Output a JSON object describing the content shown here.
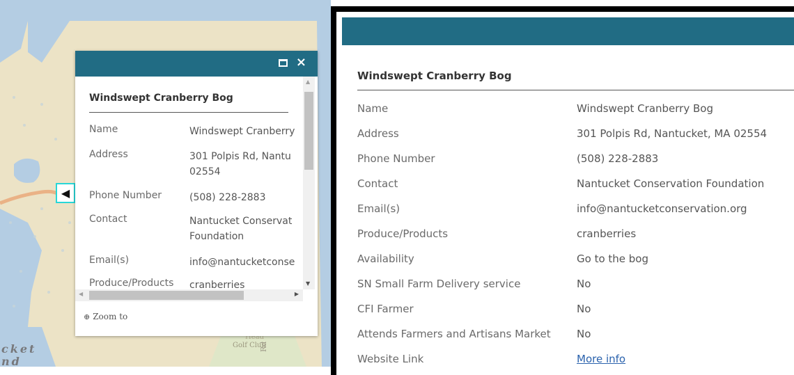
{
  "map": {
    "labels": {
      "ocean_line1": "cket",
      "ocean_line2": "nd",
      "golf_head": "Head",
      "golf_club": "Golf Club",
      "road": "Rd"
    }
  },
  "small_popup": {
    "pointer_icon": "chevron-left-icon",
    "maximize_icon": "maximize-icon",
    "close_icon": "close-icon",
    "close_glyph": "×",
    "title": "Windswept Cranberry Bog",
    "rows": [
      {
        "key": "Name",
        "value": "Windswept Cranberry"
      },
      {
        "key": "Address",
        "value": "301 Polpis Rd, Nantu 02554"
      },
      {
        "key": "Phone Number",
        "value": "(508) 228-2883"
      },
      {
        "key": "Contact",
        "value": "Nantucket Conservat Foundation"
      },
      {
        "key": "Email(s)",
        "value": "info@nantucketconse"
      },
      {
        "key": "Produce/Products",
        "value": "cranberries"
      }
    ],
    "zoom_label": "Zoom to"
  },
  "large_popup": {
    "title": "Windswept Cranberry Bog",
    "rows": [
      {
        "key": "Name",
        "value": "Windswept Cranberry Bog"
      },
      {
        "key": "Address",
        "value": "301 Polpis Rd, Nantucket, MA 02554"
      },
      {
        "key": "Phone Number",
        "value": "(508) 228-2883"
      },
      {
        "key": "Contact",
        "value": "Nantucket Conservation Foundation"
      },
      {
        "key": "Email(s)",
        "value": "info@nantucketconservation.org"
      },
      {
        "key": "Produce/Products",
        "value": "cranberries"
      },
      {
        "key": "Availability",
        "value": "Go to the bog"
      },
      {
        "key": "SN Small Farm Delivery service",
        "value": "No"
      },
      {
        "key": "CFI Farmer",
        "value": "No"
      },
      {
        "key": "Attends Farmers and Artisans Market",
        "value": "No"
      },
      {
        "key": "Website Link",
        "value": "More info"
      }
    ]
  },
  "colors": {
    "header": "#216c84",
    "link": "#2a62ad",
    "water": "#b4cde3",
    "land": "#ece3c6"
  }
}
